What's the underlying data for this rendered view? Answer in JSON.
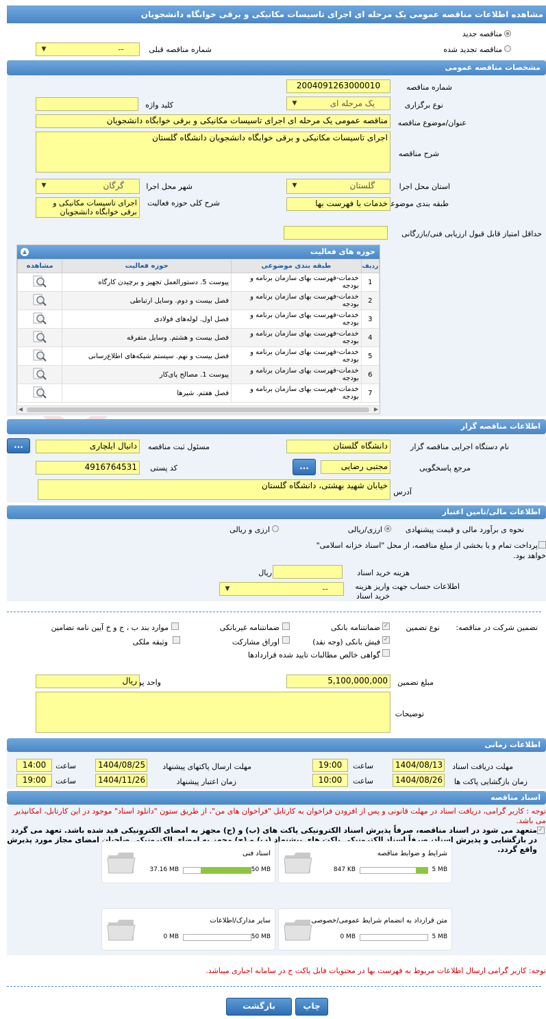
{
  "page_title": "مشاهده اطلاعات مناقصه عمومی یک مرحله ای اجرای تاسیسات مکانیکی و برقی خوابگاه دانشجویان",
  "top": {
    "new_tender": "مناقصه جدید",
    "renewed_tender": "مناقصه تجدید شده",
    "prev_number_label": "شماره مناقصه قبلی",
    "prev_number_value": "--"
  },
  "general": {
    "title": "مشخصات مناقصه عمومی",
    "number_label": "شماره مناقصه",
    "number_value": "2004091263000010",
    "type_label": "نوع برگزاری",
    "type_value": "یک مرحله ای",
    "keyword_label": "کلید واژه",
    "keyword_value": "",
    "subject_label": "عنوان/موضوع مناقصه",
    "subject_value": "مناقصه عمومی یک مرحله ای اجرای تاسیسات مکانیکی و برقی خوابگاه دانشجویان",
    "desc_label": "شرح مناقصه",
    "desc_value": "اجرای تاسیسات مکانیکی و برقی خوابگاه دانشجویان دانشگاه گلستان",
    "province_label": "استان محل اجرا",
    "province_value": "گلستان",
    "city_label": "شهر محل اجرا",
    "city_value": "گرگان",
    "category_label": "طبقه بندی موضوعی",
    "category_value": "خدمات با فهرست بها",
    "scope_label": "شرح کلی حوزه فعالیت",
    "scope_value": "اجرای تاسیسات مکانیکی و برقی خوابگاه دانشجویان",
    "min_score_label": "حداقل امتیاز قابل قبول ارزیابی فنی/بازرگانی",
    "min_score_value": ""
  },
  "activity": {
    "title": "حوزه های فعالیت",
    "col_row": "ردیف",
    "col_cat": "طبقه بندی موضوعی",
    "col_field": "حوزه فعالیت",
    "col_view": "مشاهده",
    "rows": [
      {
        "n": "1",
        "cat": "خدمات-فهرست بهای سازمان برنامه و بودجه",
        "field": "پیوست 5. دستورالعمل تجهیز و برچیدن کارگاه"
      },
      {
        "n": "2",
        "cat": "خدمات-فهرست بهای سازمان برنامه و بودجه",
        "field": "فصل بیست و دوم. وسایل ارتباطی"
      },
      {
        "n": "3",
        "cat": "خدمات-فهرست بهای سازمان برنامه و بودجه",
        "field": "فصل اول. لوله‌های فولادی"
      },
      {
        "n": "4",
        "cat": "خدمات-فهرست بهای سازمان برنامه و بودجه",
        "field": "فصل بیست و هشتم. وسایل متفرقه"
      },
      {
        "n": "5",
        "cat": "خدمات-فهرست بهای سازمان برنامه و بودجه",
        "field": "فصل بیست و نهم. سیستم شبکه‌های اطلاع‌رسانی"
      },
      {
        "n": "6",
        "cat": "خدمات-فهرست بهای سازمان برنامه و بودجه",
        "field": "پیوست 1. مصالح پای‌کار"
      },
      {
        "n": "7",
        "cat": "خدمات-فهرست بهای سازمان برنامه و بودجه",
        "field": "فصل هفتم. شیرها"
      }
    ]
  },
  "org": {
    "title": "اطلاعات مناقصه گزار",
    "name_label": "نام دستگاه اجرایی مناقصه گزار",
    "name_value": "دانشگاه گلستان",
    "resp_label": "مسئول ثبت مناقصه",
    "resp_value": "دانیال ایلچاری",
    "ref_label": "مرجع پاسخگویی",
    "ref_value": "مجتبی رضایی",
    "postal_label": "کد پستی",
    "postal_value": "4916764531",
    "addr_label": "آدرس",
    "addr_value": "خیابان شهید بهشتی، دانشگاه گلستان",
    "more": "..."
  },
  "finance": {
    "title": "اطلاعات مالی/تامین اعتبار",
    "estimate_label": "نحوه ی برآورد مالی و قیمت پیشنهادی",
    "opt_rial": "ارزی/ریالی",
    "opt_fx": "ارزی و ریالی",
    "treasury_text1": "پرداخت تمام و یا بخشی از مبلغ مناقصه، از محل \"اسناد خزانه اسلامی\"",
    "treasury_text2": "خواهد بود.",
    "fee_label": "هزینه خرید اسناد",
    "fee_unit": "ریال",
    "account_label1": "اطلاعات حساب جهت واریز هزینه",
    "account_label2": "خرید اسناد",
    "account_value": "--"
  },
  "guarantee": {
    "label": "تضمین شرکت در مناقصه:",
    "type_label": "نوع تضمین",
    "bank": "ضمانتنامه بانکی",
    "nonbank": "ضمانتنامه غیربانکی",
    "clause": "موارد بند ب ، ج و خ آیین نامه تضامین",
    "cash": "فیش بانکی (وجه نقد)",
    "bonds": "اوراق مشارکت",
    "property": "وثیقه ملکی",
    "contract": "گواهی خالص مطالبات تایید شده قراردادها",
    "amount_label": "مبلغ تضمین",
    "amount_value": "5,100,000,000",
    "currency_label": "واحد پول",
    "currency_value": "ریال",
    "notes_label": "توضیحات"
  },
  "times": {
    "title": "اطلاعات زمانی",
    "recv_label": "مهلت دریافت اسناد",
    "recv_date": "1404/08/13",
    "recv_time": "19:00",
    "send_label": "مهلت ارسال پاکتهای پیشنهاد",
    "send_date": "1404/08/25",
    "send_time": "14:00",
    "open_label": "زمان بازگشایی پاکت ها",
    "open_date": "1404/08/26",
    "open_time": "10:00",
    "valid_label": "زمان اعتبار پیشنهاد",
    "valid_date": "1404/11/26",
    "valid_time": "19:00",
    "hour": "ساعت"
  },
  "docs": {
    "title": "اسناد مناقصه",
    "note1": "توجه : کاربر گرامی، دریافت اسناد در مهلت قانونی و پس از افزودن فراخوان به کارتابل \"فراخوان های من\"، از طریق ستون \"دانلود اسناد\" موجود در این کارتابل، امکانپذیر می باشد.",
    "commit": "متعهد می شود در اسناد مناقصه، صرفاً پذیرش اسناد الکترونیکی پاکت های (ب) و (ج) مجهز به امضای الکترونیکی قید شده باشد. تعهد می گردد در بازگشایی و پذیرش اسناد، صرفاً اسناد الکترونیکی پاکت های پیشنهاد (ب) و (ج) مجهز به امضای الکترونیکی صاحبان امضای مجاز مورد پذیرش واقع گردد.",
    "cards": [
      {
        "name": "شرایط و ضوابط مناقصه",
        "used": "847 KB",
        "max": "5 MB",
        "fill": 0.17
      },
      {
        "name": "اسناد فنی",
        "used": "37.16 MB",
        "max": "50 MB",
        "fill": 0.74
      },
      {
        "name": "متن قرارداد به انضمام شرایط عمومی/خصوصی",
        "used": "0 MB",
        "max": "5 MB",
        "fill": 0
      },
      {
        "name": "سایر مدارک/اطلاعات",
        "used": "0 MB",
        "max": "50 MB",
        "fill": 0
      }
    ],
    "note2": "توجه: کاربر گرامی ارسال اطلاعات مربوط به فهرست بها در محتویات فایل پاکت ج در سامانه اجباری میباشد."
  },
  "actions": {
    "print": "چاپ",
    "back": "بازگشت"
  },
  "watermark": "AriaTender.neT"
}
